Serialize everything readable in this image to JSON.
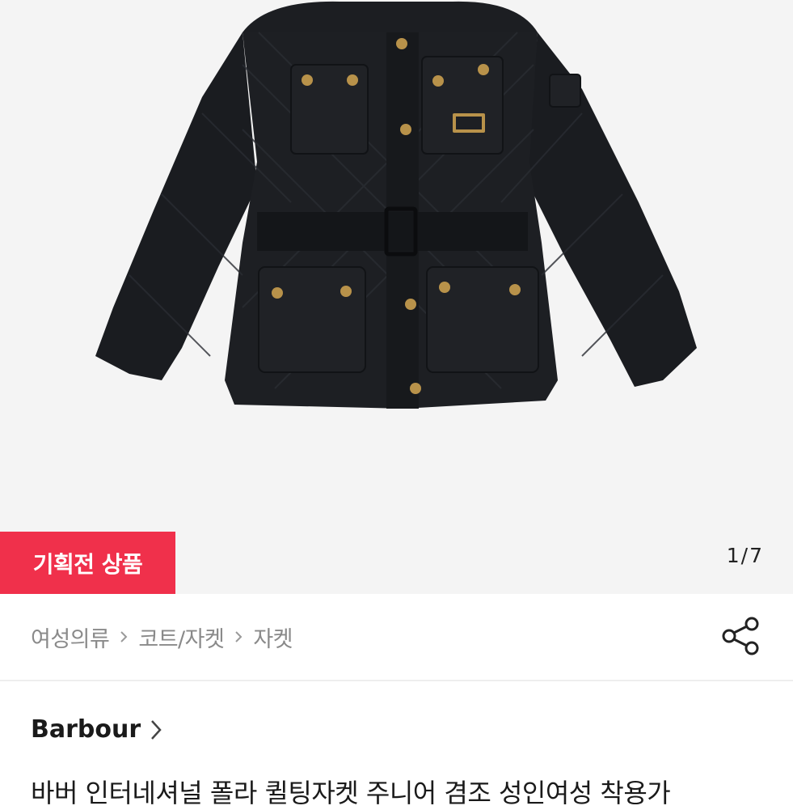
{
  "product_image": {
    "alt_icon": "jacket-photo",
    "promo_badge": "기획전 상품",
    "counter": {
      "current": "1",
      "separator": "/",
      "total": "7"
    }
  },
  "breadcrumb": {
    "items": [
      "여성의류",
      "코트/자켓",
      "자켓"
    ],
    "separator_icon": "chevron-right-icon"
  },
  "share_icon": "share-icon",
  "brand": {
    "name": "Barbour",
    "chevron_icon": "chevron-right-icon"
  },
  "product": {
    "title": "바버 인터네셔널 폴라 퀼팅자켓 주니어 겸조 성인여성 착용가"
  },
  "colors": {
    "promo": "#f0304b",
    "jacket": "#1b1d21",
    "brass": "#b8924a"
  }
}
